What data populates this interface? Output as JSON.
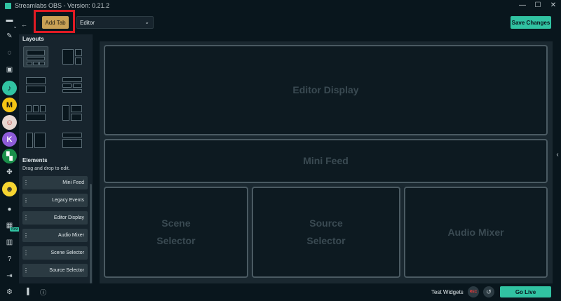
{
  "window": {
    "title": "Streamlabs OBS - Version: 0.21.2",
    "minimize": "—",
    "maximize": "☐",
    "close": "✕"
  },
  "topbar": {
    "add_tab_label": "Add Tab",
    "tab_select_value": "Editor",
    "save_label": "Save Changes"
  },
  "panel": {
    "layouts_title": "Layouts",
    "elements_title": "Elements",
    "elements_hint": "Drag and drop to edit.",
    "elements": [
      "Mini Feed",
      "Legacy Events",
      "Editor Display",
      "Audio Mixer",
      "Scene Selector",
      "Source Selector"
    ]
  },
  "canvas": {
    "editor_display": "Editor Display",
    "mini_feed": "Mini Feed",
    "scene_selector_1": "Scene",
    "scene_selector_2": "Selector",
    "source_selector_1": "Source",
    "source_selector_2": "Selector",
    "audio_mixer": "Audio Mixer"
  },
  "sidebar": {
    "new_badge": "New"
  },
  "footer": {
    "test_widgets": "Test Widgets",
    "rec": "REC",
    "go_live": "Go Live"
  },
  "colors": {
    "accent": "#31c3a2",
    "add_tab": "#c9a155",
    "highlight": "#e01b24"
  }
}
